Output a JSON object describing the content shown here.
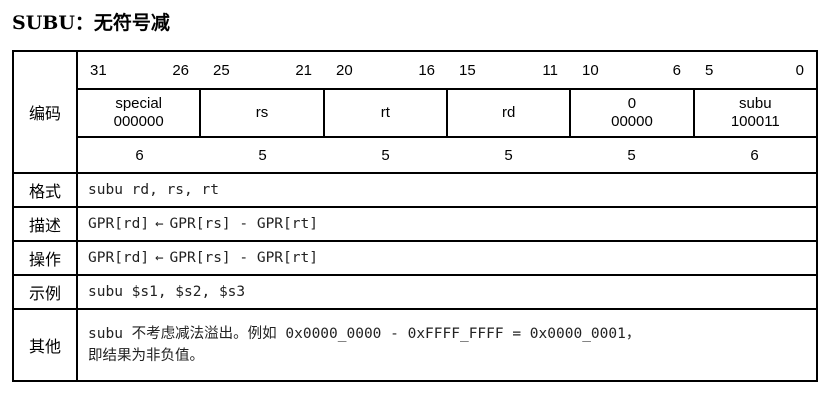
{
  "title": "SUBU：无符号减",
  "encoding": {
    "label": "编码",
    "bit_ranges": [
      {
        "hi": "31",
        "lo": "26"
      },
      {
        "hi": "25",
        "lo": "21"
      },
      {
        "hi": "20",
        "lo": "16"
      },
      {
        "hi": "15",
        "lo": "11"
      },
      {
        "hi": "10",
        "lo": "6"
      },
      {
        "hi": "5",
        "lo": "0"
      }
    ],
    "fields": [
      {
        "name": "special",
        "value": "000000"
      },
      {
        "name": "rs",
        "value": ""
      },
      {
        "name": "rt",
        "value": ""
      },
      {
        "name": "rd",
        "value": ""
      },
      {
        "name": "0",
        "value": "00000"
      },
      {
        "name": "subu",
        "value": "100011"
      }
    ],
    "widths": [
      "6",
      "5",
      "5",
      "5",
      "5",
      "6"
    ]
  },
  "rows": {
    "format": {
      "label": "格式",
      "text": "subu rd, rs, rt"
    },
    "description": {
      "label": "描述",
      "dest": "GPR[rd]",
      "arrow": "←",
      "expr": "GPR[rs] - GPR[rt]"
    },
    "operation": {
      "label": "操作",
      "dest": "GPR[rd]",
      "arrow": "←",
      "expr": "GPR[rs] - GPR[rt]"
    },
    "example": {
      "label": "示例",
      "text": "subu $s1, $s2, $s3"
    },
    "other": {
      "label": "其他",
      "line1": "subu 不考虑减法溢出。例如 0x0000_0000 - 0xFFFF_FFFF = 0x0000_0001，",
      "line2": "即结果为非负值。"
    }
  }
}
